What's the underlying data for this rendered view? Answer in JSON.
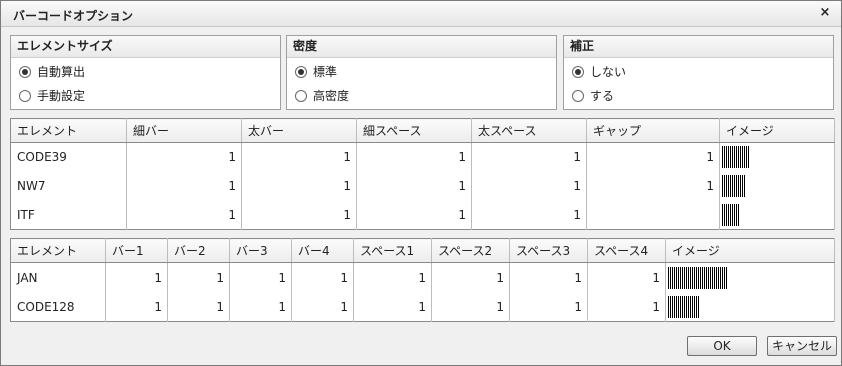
{
  "dialog": {
    "title": "バーコードオプション",
    "close_glyph": "×"
  },
  "panels": {
    "size": {
      "label": "エレメントサイズ",
      "options": [
        "自動算出",
        "手動設定"
      ],
      "selected": 0
    },
    "density": {
      "label": "密度",
      "options": [
        "標準",
        "高密度"
      ],
      "selected": 0
    },
    "correction": {
      "label": "補正",
      "options": [
        "しない",
        "する"
      ],
      "selected": 0
    }
  },
  "table1": {
    "headers": [
      "エレメント",
      "細バー",
      "太バー",
      "細スペース",
      "太スペース",
      "ギャップ",
      "イメージ"
    ],
    "rows": [
      {
        "name": "CODE39",
        "values": [
          "1",
          "1",
          "1",
          "1",
          "1"
        ]
      },
      {
        "name": "NW7",
        "values": [
          "1",
          "1",
          "1",
          "1",
          "1"
        ]
      },
      {
        "name": "ITF",
        "values": [
          "1",
          "1",
          "1",
          "1",
          ""
        ]
      }
    ]
  },
  "table2": {
    "headers": [
      "エレメント",
      "バー1",
      "バー2",
      "バー3",
      "バー4",
      "スペース1",
      "スペース2",
      "スペース3",
      "スペース4",
      "イメージ"
    ],
    "rows": [
      {
        "name": "JAN",
        "values": [
          "1",
          "1",
          "1",
          "1",
          "1",
          "1",
          "1",
          "1"
        ]
      },
      {
        "name": "CODE128",
        "values": [
          "1",
          "1",
          "1",
          "1",
          "1",
          "1",
          "1",
          "1"
        ]
      }
    ]
  },
  "buttons": {
    "ok": "OK",
    "cancel": "キャンセル"
  }
}
